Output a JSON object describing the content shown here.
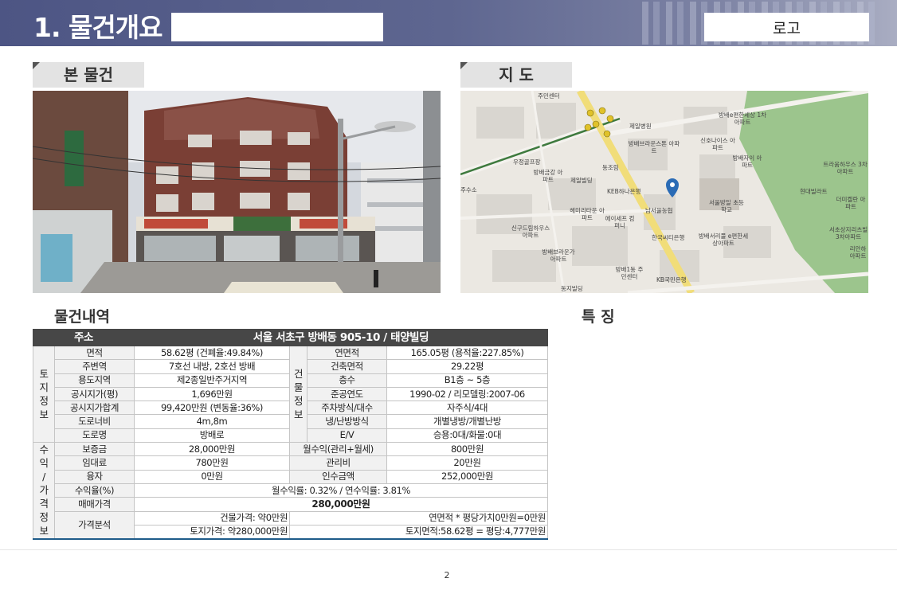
{
  "header": {
    "title": "1. 물건개요",
    "logo": "로고"
  },
  "sections": {
    "photo": "본 물건",
    "map": "지 도",
    "details": "물건내역",
    "features": "특 징"
  },
  "map": {
    "labels": [
      "주민센터",
      "제일병원",
      "방배e편한세상 1차아파트",
      "방배브라운스톤 아파트",
      "신호나이스 아파트",
      "우정골프장",
      "방배금강 아파트",
      "동조림",
      "제일빌딩",
      "방배자이 아파트",
      "트라움하우스 3차아파트",
      "KEB하나은행",
      "현대빌라트",
      "더미켈란 아파트",
      "헤미리타운 아파트",
      "에이세프 컴퍼니",
      "남서울농협",
      "서울방일 초등학교",
      "신구드림하우스 아파트",
      "한국씨티은행",
      "방배서리풀 e편한세상아파트",
      "서초상지리츠빌 3차아파트",
      "리안하 아파트",
      "방배브라운가 아파트",
      "방배1동 주민센터",
      "KB국민은행",
      "동지빌딩",
      "주수소"
    ]
  },
  "table": {
    "address_label": "주소",
    "address": "서울 서초구 방배동 905-10 / 태양빌딩",
    "land_group": "토지정보",
    "building_group": "건물정보",
    "income_group": "수익/가격정보",
    "rows": [
      {
        "l1": "면적",
        "v1": "58.62평 (건폐율:49.84%)",
        "l2": "연면적",
        "v2": "165.05평 (용적율:227.85%)"
      },
      {
        "l1": "주변역",
        "v1": "7호선 내방, 2호선 방배",
        "l2": "건축면적",
        "v2": "29.22평"
      },
      {
        "l1": "용도지역",
        "v1": "제2종일반주거지역",
        "l2": "층수",
        "v2": "B1층 ~ 5층"
      },
      {
        "l1": "공시지가(평)",
        "v1": "1,696만원",
        "l2": "준공연도",
        "v2": "1990-02 / 리모델링:2007-06"
      },
      {
        "l1": "공시지가합계",
        "v1": "99,420만원 (변동율:36%)",
        "l2": "주차방식/대수",
        "v2": "자주식/4대"
      },
      {
        "l1": "도로너비",
        "v1": "4m,8m",
        "l2": "냉/난방방식",
        "v2": "개별냉방/개별난방"
      },
      {
        "l1": "도로명",
        "v1": "방배로",
        "l2": "E/V",
        "v2": "승용:0대/화물:0대"
      }
    ],
    "income": {
      "deposit_label": "보증금",
      "deposit": "28,000만원",
      "monthly_label": "월수익(관리+월세)",
      "monthly": "800만원",
      "rent_label": "임대료",
      "rent": "780만원",
      "mgmt_label": "관리비",
      "mgmt": "20만원",
      "loan_label": "융자",
      "loan": "0만원",
      "acq_label": "인수금액",
      "acq": "252,000만원",
      "yield_label": "수익율(%)",
      "yield": "월수익률: 0.32% / 연수익률: 3.81%",
      "price_label": "매매가격",
      "price": "280,000만원",
      "analysis_label": "가격분석",
      "building_price": "건물가격: 약0만원",
      "floor_value": "연면적 * 평당가치0만원=0만원",
      "land_price": "토지가격: 약280,000만원",
      "land_area": "토지면적:58.62평 = 평당:4,777만원"
    }
  },
  "footer": {
    "page": "2"
  },
  "colors": {
    "header": "#4d5584",
    "table_header": "#474747",
    "table_border_accent": "#1f5c8a",
    "park": "#8ab57c",
    "road": "#f3e38a"
  }
}
